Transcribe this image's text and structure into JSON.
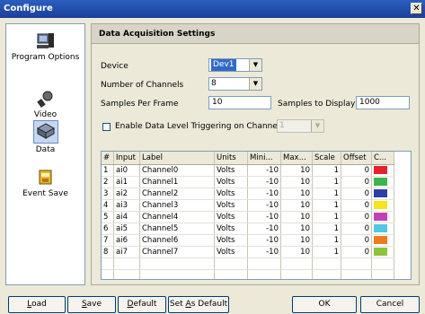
{
  "window": {
    "title": "Configure",
    "close_glyph": "✕"
  },
  "sidebar": {
    "items": [
      {
        "label": "Program Options",
        "icon": "program-options-icon"
      },
      {
        "label": "Video",
        "icon": "video-icon"
      },
      {
        "label": "Data",
        "icon": "data-icon",
        "selected": true
      },
      {
        "label": "Event Save",
        "icon": "event-save-icon"
      }
    ]
  },
  "panel": {
    "header": "Data Acquisition Settings",
    "device_label": "Device",
    "device_value": "Dev1",
    "channels_label": "Number of Channels",
    "channels_value": "8",
    "spf_label": "Samples Per Frame",
    "spf_value": "10",
    "std_label": "Samples to Display",
    "std_value": "1000",
    "trigger_label": "Enable Data Level Triggering on Channel #",
    "trigger_value": "1",
    "trigger_checked": false
  },
  "table": {
    "columns": [
      "#",
      "Input",
      "Label",
      "Units",
      "Mini...",
      "Max...",
      "Scale",
      "Offset",
      "C..."
    ],
    "rows": [
      {
        "n": "1",
        "input": "ai0",
        "label": "Channel0",
        "units": "Volts",
        "min": "-10",
        "max": "10",
        "scale": "1",
        "offset": "0",
        "color": "#e8202a"
      },
      {
        "n": "2",
        "input": "ai1",
        "label": "Channel1",
        "units": "Volts",
        "min": "-10",
        "max": "10",
        "scale": "1",
        "offset": "0",
        "color": "#3cb44b"
      },
      {
        "n": "3",
        "input": "ai2",
        "label": "Channel2",
        "units": "Volts",
        "min": "-10",
        "max": "10",
        "scale": "1",
        "offset": "0",
        "color": "#2a3fa8"
      },
      {
        "n": "4",
        "input": "ai3",
        "label": "Channel3",
        "units": "Volts",
        "min": "-10",
        "max": "10",
        "scale": "1",
        "offset": "0",
        "color": "#f5e51a"
      },
      {
        "n": "5",
        "input": "ai4",
        "label": "Channel4",
        "units": "Volts",
        "min": "-10",
        "max": "10",
        "scale": "1",
        "offset": "0",
        "color": "#c23fb8"
      },
      {
        "n": "6",
        "input": "ai5",
        "label": "Channel5",
        "units": "Volts",
        "min": "-10",
        "max": "10",
        "scale": "1",
        "offset": "0",
        "color": "#4fc8e0"
      },
      {
        "n": "7",
        "input": "ai6",
        "label": "Channel6",
        "units": "Volts",
        "min": "-10",
        "max": "10",
        "scale": "1",
        "offset": "0",
        "color": "#f07a1e"
      },
      {
        "n": "8",
        "input": "ai7",
        "label": "Channel7",
        "units": "Volts",
        "min": "-10",
        "max": "10",
        "scale": "1",
        "offset": "0",
        "color": "#8cc43c"
      }
    ]
  },
  "buttons": {
    "load": {
      "label": "oad",
      "accel": "L"
    },
    "save": {
      "label": "ave",
      "accel": "S"
    },
    "default": {
      "label": "efault",
      "accel": "D"
    },
    "set_as_default": {
      "pre": "Set ",
      "accel": "A",
      "post": "s Default"
    },
    "ok": "OK",
    "cancel": "Cancel"
  }
}
